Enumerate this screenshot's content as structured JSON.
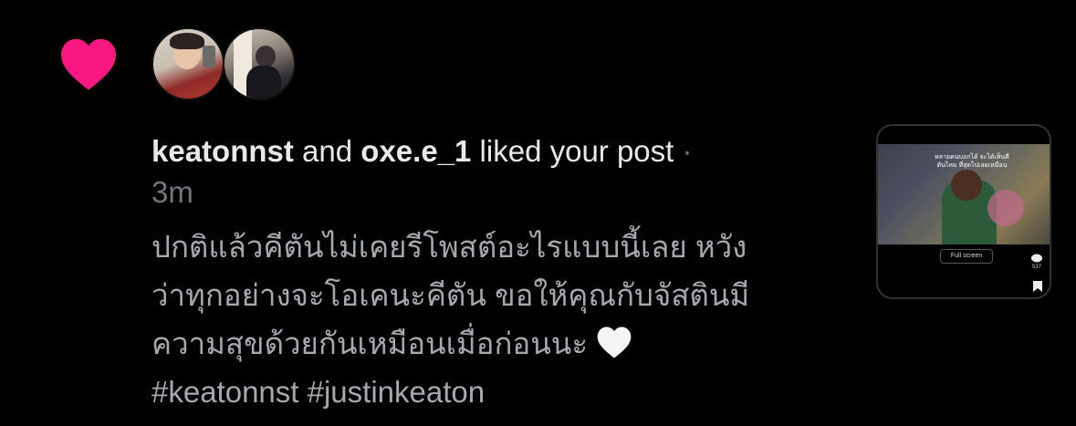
{
  "notification": {
    "icon": "heart-icon",
    "icon_color": "#f91880",
    "users": [
      "keatonnst",
      "oxe.e_1"
    ],
    "connector": "and",
    "action": "liked your post",
    "separator": "·",
    "time": "3m"
  },
  "post": {
    "line1": "ปกติแล้วคีตันไม่เคยรีโพสต์อะไรแบบนี้เลย หวัง",
    "line2": "ว่าทุกอย่างจะโอเคนะคีตัน ขอให้คุณกับจัสตินมี",
    "line3": "ความสุขด้วยกันเหมือนเมื่อก่อนนะ",
    "emoji": "white-heart-icon",
    "hashtags": "#keatonnst #justinkeaton"
  },
  "thumbnail": {
    "fullscreen_label": "Full screen",
    "comment_count": "537",
    "caption": "หลายคนบอกได้ จะได้เห็นคีตันไหม ที่สุดไปเลยเหมือน"
  }
}
